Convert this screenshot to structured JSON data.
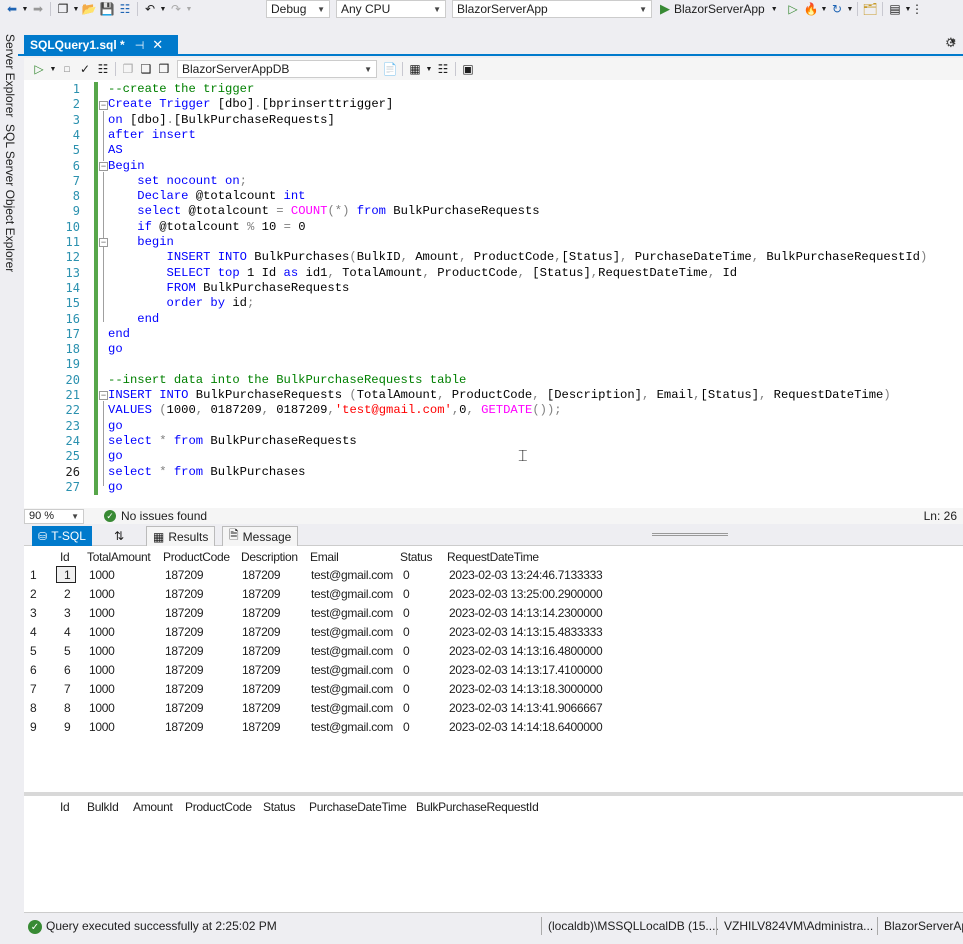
{
  "toolbar": {
    "config": "Debug",
    "platform": "Any CPU",
    "project": "BlazorServerApp",
    "run_label": "BlazorServerApp"
  },
  "side_panel": {
    "items": [
      "Server Explorer",
      "SQL Server Object Explorer"
    ]
  },
  "doc_tab": {
    "title": "SQLQuery1.sql *",
    "pin": "⊣",
    "close": "✕"
  },
  "editor_toolbar": {
    "database": "BlazorServerAppDB"
  },
  "editor": {
    "line_numbers": [
      "1",
      "2",
      "3",
      "4",
      "5",
      "6",
      "7",
      "8",
      "9",
      "10",
      "11",
      "12",
      "13",
      "14",
      "15",
      "16",
      "17",
      "18",
      "19",
      "20",
      "21",
      "22",
      "23",
      "24",
      "25",
      "26",
      "27"
    ],
    "lines": [
      [
        [
          "cm",
          "--create the trigger"
        ]
      ],
      [
        [
          "kw",
          "Create Trigger "
        ],
        [
          "id",
          "[dbo]"
        ],
        [
          "gr",
          "."
        ],
        [
          "id",
          "[bprinserttrigger]"
        ]
      ],
      [
        [
          "kw",
          "on "
        ],
        [
          "id",
          "[dbo]"
        ],
        [
          "gr",
          "."
        ],
        [
          "id",
          "[BulkPurchaseRequests]"
        ]
      ],
      [
        [
          "kw",
          "after insert"
        ]
      ],
      [
        [
          "kw",
          "AS"
        ]
      ],
      [
        [
          "kw",
          "Begin"
        ]
      ],
      [
        [
          "id",
          "    "
        ],
        [
          "kw",
          "set nocount on"
        ],
        [
          "gr",
          ";"
        ]
      ],
      [
        [
          "id",
          "    "
        ],
        [
          "kw",
          "Declare "
        ],
        [
          "id",
          "@totalcount "
        ],
        [
          "kw",
          "int"
        ]
      ],
      [
        [
          "id",
          "    "
        ],
        [
          "kw",
          "select "
        ],
        [
          "id",
          "@totalcount "
        ],
        [
          "gr",
          "= "
        ],
        [
          "fn",
          "COUNT"
        ],
        [
          "gr",
          "(*) "
        ],
        [
          "kw",
          "from "
        ],
        [
          "id",
          "BulkPurchaseRequests"
        ]
      ],
      [
        [
          "id",
          "    "
        ],
        [
          "kw",
          "if "
        ],
        [
          "id",
          "@totalcount "
        ],
        [
          "gr",
          "% "
        ],
        [
          "id",
          "10 "
        ],
        [
          "gr",
          "= "
        ],
        [
          "id",
          "0"
        ]
      ],
      [
        [
          "id",
          "    "
        ],
        [
          "kw",
          "begin"
        ]
      ],
      [
        [
          "id",
          "        "
        ],
        [
          "kw",
          "INSERT INTO "
        ],
        [
          "id",
          "BulkPurchases"
        ],
        [
          "gr",
          "("
        ],
        [
          "id",
          "BulkID"
        ],
        [
          "gr",
          ", "
        ],
        [
          "id",
          "Amount"
        ],
        [
          "gr",
          ", "
        ],
        [
          "id",
          "ProductCode"
        ],
        [
          "gr",
          ","
        ],
        [
          "id",
          "[Status]"
        ],
        [
          "gr",
          ", "
        ],
        [
          "id",
          "PurchaseDateTime"
        ],
        [
          "gr",
          ", "
        ],
        [
          "id",
          "BulkPurchaseRequestId"
        ],
        [
          "gr",
          ")"
        ]
      ],
      [
        [
          "id",
          "        "
        ],
        [
          "kw",
          "SELECT top "
        ],
        [
          "id",
          "1 Id "
        ],
        [
          "kw",
          "as "
        ],
        [
          "id",
          "id1"
        ],
        [
          "gr",
          ", "
        ],
        [
          "id",
          "TotalAmount"
        ],
        [
          "gr",
          ", "
        ],
        [
          "id",
          "ProductCode"
        ],
        [
          "gr",
          ", "
        ],
        [
          "id",
          "[Status]"
        ],
        [
          "gr",
          ","
        ],
        [
          "id",
          "RequestDateTime"
        ],
        [
          "gr",
          ", "
        ],
        [
          "id",
          "Id"
        ]
      ],
      [
        [
          "id",
          "        "
        ],
        [
          "kw",
          "FROM "
        ],
        [
          "id",
          "BulkPurchaseRequests"
        ]
      ],
      [
        [
          "id",
          "        "
        ],
        [
          "kw",
          "order by "
        ],
        [
          "id",
          "id"
        ],
        [
          "gr",
          ";"
        ]
      ],
      [
        [
          "id",
          "    "
        ],
        [
          "kw",
          "end"
        ]
      ],
      [
        [
          "kw",
          "end"
        ]
      ],
      [
        [
          "kw",
          "go"
        ]
      ],
      [
        [
          "id",
          ""
        ]
      ],
      [
        [
          "cm",
          "--insert data into the BulkPurchaseRequests table"
        ]
      ],
      [
        [
          "kw",
          "INSERT INTO "
        ],
        [
          "id",
          "BulkPurchaseRequests "
        ],
        [
          "gr",
          "("
        ],
        [
          "id",
          "TotalAmount"
        ],
        [
          "gr",
          ", "
        ],
        [
          "id",
          "ProductCode"
        ],
        [
          "gr",
          ", "
        ],
        [
          "id",
          "[Description]"
        ],
        [
          "gr",
          ", "
        ],
        [
          "id",
          "Email"
        ],
        [
          "gr",
          ","
        ],
        [
          "id",
          "[Status]"
        ],
        [
          "gr",
          ", "
        ],
        [
          "id",
          "RequestDateTime"
        ],
        [
          "gr",
          ")"
        ]
      ],
      [
        [
          "kw",
          "VALUES "
        ],
        [
          "gr",
          "("
        ],
        [
          "id",
          "1000"
        ],
        [
          "gr",
          ", "
        ],
        [
          "id",
          "0187209"
        ],
        [
          "gr",
          ", "
        ],
        [
          "id",
          "0187209"
        ],
        [
          "gr",
          ","
        ],
        [
          "st",
          "'test@gmail.com'"
        ],
        [
          "gr",
          ","
        ],
        [
          "id",
          "0"
        ],
        [
          "gr",
          ", "
        ],
        [
          "fn",
          "GETDATE"
        ],
        [
          "gr",
          "());"
        ]
      ],
      [
        [
          "kw",
          "go"
        ]
      ],
      [
        [
          "kw",
          "select "
        ],
        [
          "gr",
          "* "
        ],
        [
          "kw",
          "from "
        ],
        [
          "id",
          "BulkPurchaseRequests"
        ]
      ],
      [
        [
          "kw",
          "go"
        ]
      ],
      [
        [
          "kw",
          "select "
        ],
        [
          "gr",
          "* "
        ],
        [
          "kw",
          "from "
        ],
        [
          "id",
          "BulkPurchases"
        ]
      ],
      [
        [
          "kw",
          "go"
        ]
      ]
    ]
  },
  "editor_status": {
    "zoom": "90 %",
    "issues": "No issues found",
    "position": "Ln: 26"
  },
  "result_tabs": {
    "tsql": "T-SQL",
    "results": "Results",
    "message": "Message"
  },
  "grid1": {
    "columns": [
      "Id",
      "TotalAmount",
      "ProductCode",
      "Description",
      "Email",
      "Status",
      "RequestDateTime"
    ],
    "rows": [
      [
        "1",
        "1",
        "1000",
        "187209",
        "187209",
        "test@gmail.com",
        "0",
        "2023-02-03 13:24:46.7133333"
      ],
      [
        "2",
        "2",
        "1000",
        "187209",
        "187209",
        "test@gmail.com",
        "0",
        "2023-02-03 13:25:00.2900000"
      ],
      [
        "3",
        "3",
        "1000",
        "187209",
        "187209",
        "test@gmail.com",
        "0",
        "2023-02-03 14:13:14.2300000"
      ],
      [
        "4",
        "4",
        "1000",
        "187209",
        "187209",
        "test@gmail.com",
        "0",
        "2023-02-03 14:13:15.4833333"
      ],
      [
        "5",
        "5",
        "1000",
        "187209",
        "187209",
        "test@gmail.com",
        "0",
        "2023-02-03 14:13:16.4800000"
      ],
      [
        "6",
        "6",
        "1000",
        "187209",
        "187209",
        "test@gmail.com",
        "0",
        "2023-02-03 14:13:17.4100000"
      ],
      [
        "7",
        "7",
        "1000",
        "187209",
        "187209",
        "test@gmail.com",
        "0",
        "2023-02-03 14:13:18.3000000"
      ],
      [
        "8",
        "8",
        "1000",
        "187209",
        "187209",
        "test@gmail.com",
        "0",
        "2023-02-03 14:13:41.9066667"
      ],
      [
        "9",
        "9",
        "1000",
        "187209",
        "187209",
        "test@gmail.com",
        "0",
        "2023-02-03 14:14:18.6400000"
      ]
    ]
  },
  "grid2": {
    "columns": [
      "Id",
      "BulkId",
      "Amount",
      "ProductCode",
      "Status",
      "PurchaseDateTime",
      "BulkPurchaseRequestId"
    ]
  },
  "bottom_status": {
    "message": "Query executed successfully at 2:25:02 PM",
    "server": "(localdb)\\MSSQLLocalDB (15....",
    "user": "VZHILV824VM\\Administra...",
    "database": "BlazorServerAp"
  },
  "colors": {
    "accent": "#007acc",
    "keyword": "#0000ff",
    "comment": "#008000",
    "function": "#ff00ff",
    "string": "#ff0000",
    "success": "#388a34"
  }
}
